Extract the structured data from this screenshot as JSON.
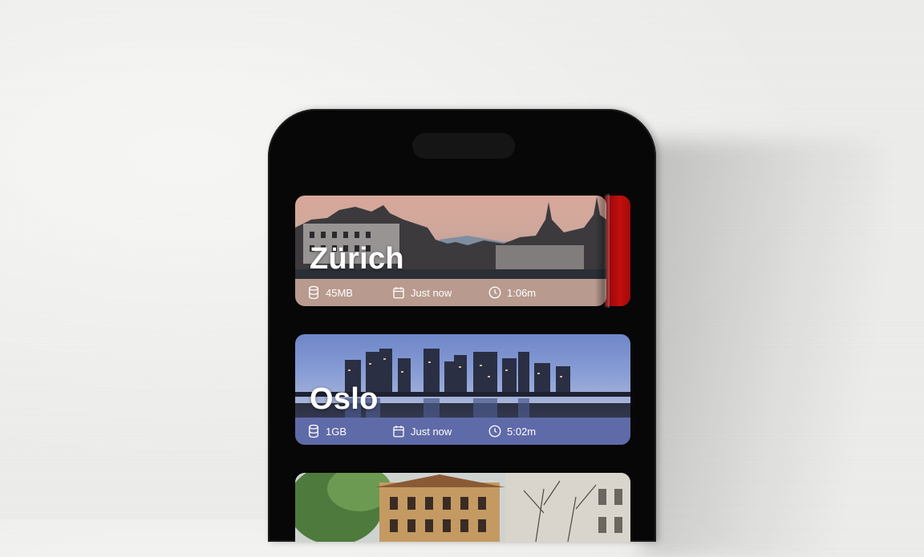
{
  "cards": [
    {
      "city": "Zürich",
      "size": "45MB",
      "date": "Just now",
      "duration": "1:06m",
      "bar_color": "#b89a8e",
      "accent_edge": "#c40e0e"
    },
    {
      "city": "Oslo",
      "size": "1GB",
      "date": "Just now",
      "duration": "5:02m",
      "bar_color": "#5f6aa8"
    },
    {
      "city": "",
      "size": "",
      "date": "",
      "duration": ""
    }
  ],
  "icons": {
    "size": "database-icon",
    "date": "calendar-icon",
    "duration": "clock-icon"
  }
}
